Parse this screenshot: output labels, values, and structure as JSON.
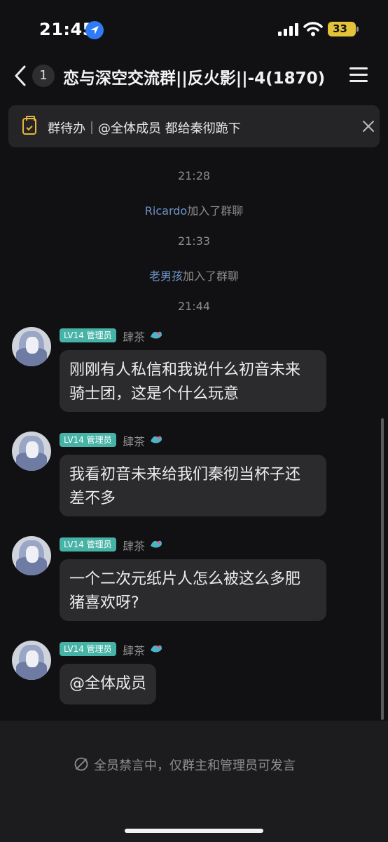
{
  "status_bar": {
    "time": "21:45",
    "battery": "33"
  },
  "nav": {
    "unread_count": "1",
    "title": "恋与深空交流群||反火影||-4(1870)"
  },
  "todo_banner": {
    "text": "群待办｜@全体成员 都给秦彻跪下"
  },
  "system_events": [
    {
      "time": "21:28",
      "name": "Ricardo",
      "action": "加入了群聊"
    },
    {
      "time": "21:33",
      "name": "老男孩",
      "action": "加入了群聊"
    },
    {
      "time": "21:44"
    }
  ],
  "messages": [
    {
      "badge": "LV14 管理员",
      "sender": "肆茶",
      "text": "刚刚有人私信和我说什么初音未来\n骑士团，这是个什么玩意"
    },
    {
      "badge": "LV14 管理员",
      "sender": "肆茶",
      "text": "我看初音未来给我们秦彻当杯子还\n差不多"
    },
    {
      "badge": "LV14 管理员",
      "sender": "肆茶",
      "text": "一个二次元纸片人怎么被这么多肥\n猪喜欢呀?"
    },
    {
      "badge": "LV14 管理员",
      "sender": "肆茶",
      "text": "@全体成员"
    }
  ],
  "input_area": {
    "mute_notice": "全员禁言中，仅群主和管理员可发言"
  },
  "colors": {
    "background": "#111113",
    "bubble": "#2b2b2e",
    "badge": "#47b3a7",
    "link_name": "#6f93c8",
    "battery": "#e2c33a",
    "todo_icon": "#e8b73a"
  },
  "icons": [
    "location-arrow-icon",
    "signal-icon",
    "wifi-icon",
    "battery-icon",
    "back-chevron-icon",
    "menu-icon",
    "todo-clipboard-icon",
    "close-icon",
    "mute-icon"
  ]
}
